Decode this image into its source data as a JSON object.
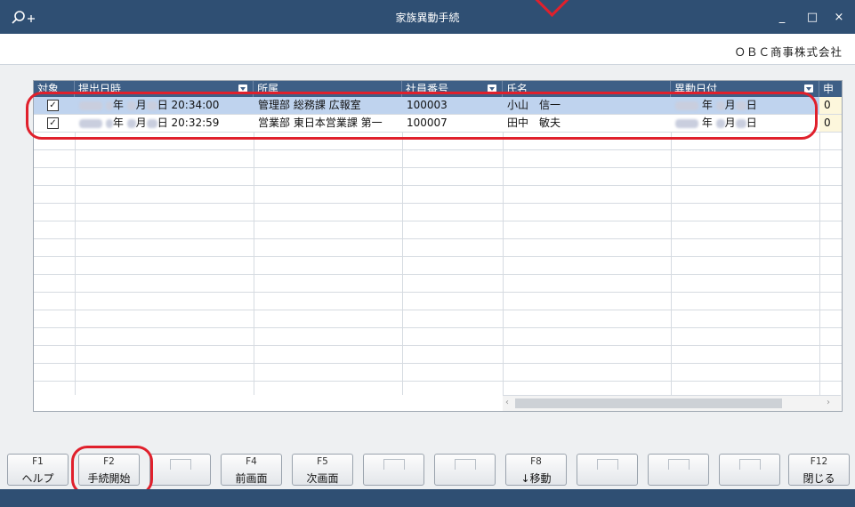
{
  "window": {
    "title": "家族異動手続",
    "minimize": "_",
    "maximize": "□",
    "close": "×"
  },
  "company": "ＯＢＣ商事株式会社",
  "table": {
    "headers": [
      "対象",
      "提出日時",
      "所属",
      "社員番号",
      "氏名",
      "異動日付",
      "申"
    ],
    "rows": [
      {
        "checked": "✓",
        "date_suffix_year": "年",
        "date_suffix_month": "月",
        "date_time": "日 20:34:00",
        "dept": "管理部 総務課 広報室",
        "emp_no": "100003",
        "name": "小山　信一",
        "move_year": "年",
        "move_month": "月",
        "move_day": "日",
        "extra": "0"
      },
      {
        "checked": "✓",
        "date_suffix_year": "年",
        "date_suffix_month": "月",
        "date_time": "日 20:32:59",
        "dept": "営業部 東日本営業課 第一",
        "emp_no": "100007",
        "name": "田中　敏夫",
        "move_year": "年",
        "move_month": "月",
        "move_day": "日",
        "extra": "0"
      }
    ]
  },
  "fkeys": [
    {
      "code": "F1",
      "label": "ヘルプ"
    },
    {
      "code": "F2",
      "label": "手続開始"
    },
    {
      "code": "",
      "label": ""
    },
    {
      "code": "F4",
      "label": "前画面"
    },
    {
      "code": "F5",
      "label": "次画面"
    },
    {
      "code": "",
      "label": ""
    },
    {
      "code": "",
      "label": ""
    },
    {
      "code": "F8",
      "label": "↓移動"
    },
    {
      "code": "",
      "label": ""
    },
    {
      "code": "",
      "label": ""
    },
    {
      "code": "",
      "label": ""
    },
    {
      "code": "F12",
      "label": "閉じる"
    }
  ],
  "colors": {
    "titlebar": "#2f4f73",
    "header": "#3e5f86",
    "selected_row": "#bfd3ee",
    "highlight": "#e0202c"
  }
}
